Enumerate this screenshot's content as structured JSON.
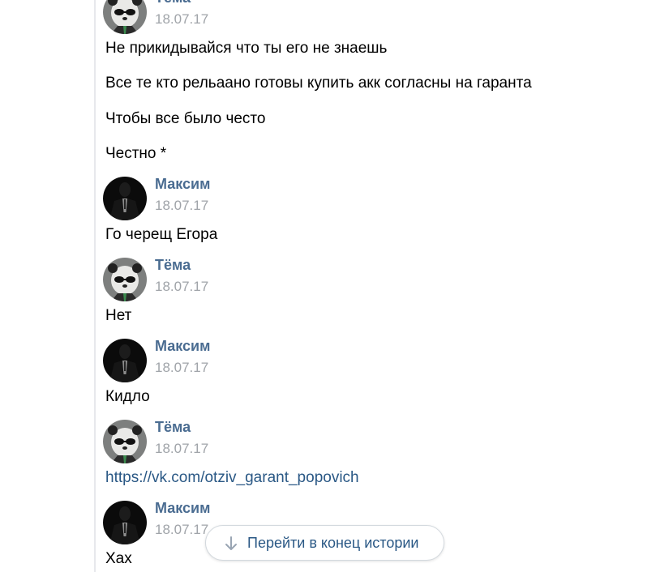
{
  "messages": [
    {
      "author": "Тёма",
      "avatar_icon": "panda-avatar-icon",
      "date": "18.07.17",
      "lines": [
        "Не прикидывайся что ты его не знаешь",
        "Все те кто рельаано готовы купить акк согласны на гаранта",
        "Чтобы все было често",
        "Честно *"
      ]
    },
    {
      "author": "Максим",
      "avatar_icon": "suit-man-avatar-icon",
      "date": "18.07.17",
      "lines": [
        "Го черещ Егора"
      ]
    },
    {
      "author": "Тёма",
      "avatar_icon": "panda-avatar-icon",
      "date": "18.07.17",
      "lines": [
        "Нет"
      ]
    },
    {
      "author": "Максим",
      "avatar_icon": "suit-man-avatar-icon",
      "date": "18.07.17",
      "lines": [
        "Кидло"
      ]
    },
    {
      "author": "Тёма",
      "avatar_icon": "panda-avatar-icon",
      "date": "18.07.17",
      "lines": [
        "https://vk.com/otziv_garant_popovich"
      ]
    },
    {
      "author": "Максим",
      "avatar_icon": "suit-man-avatar-icon",
      "date": "18.07.17",
      "lines": [
        "Хах"
      ]
    }
  ],
  "jump_button": {
    "label": "Перейти в конец истории",
    "icon": "arrow-down-icon"
  },
  "colors": {
    "author": "#4a6c91",
    "date": "#a0a4a9",
    "link": "#2a5885",
    "text": "#000000",
    "thread_line": "#e7e8ec"
  }
}
